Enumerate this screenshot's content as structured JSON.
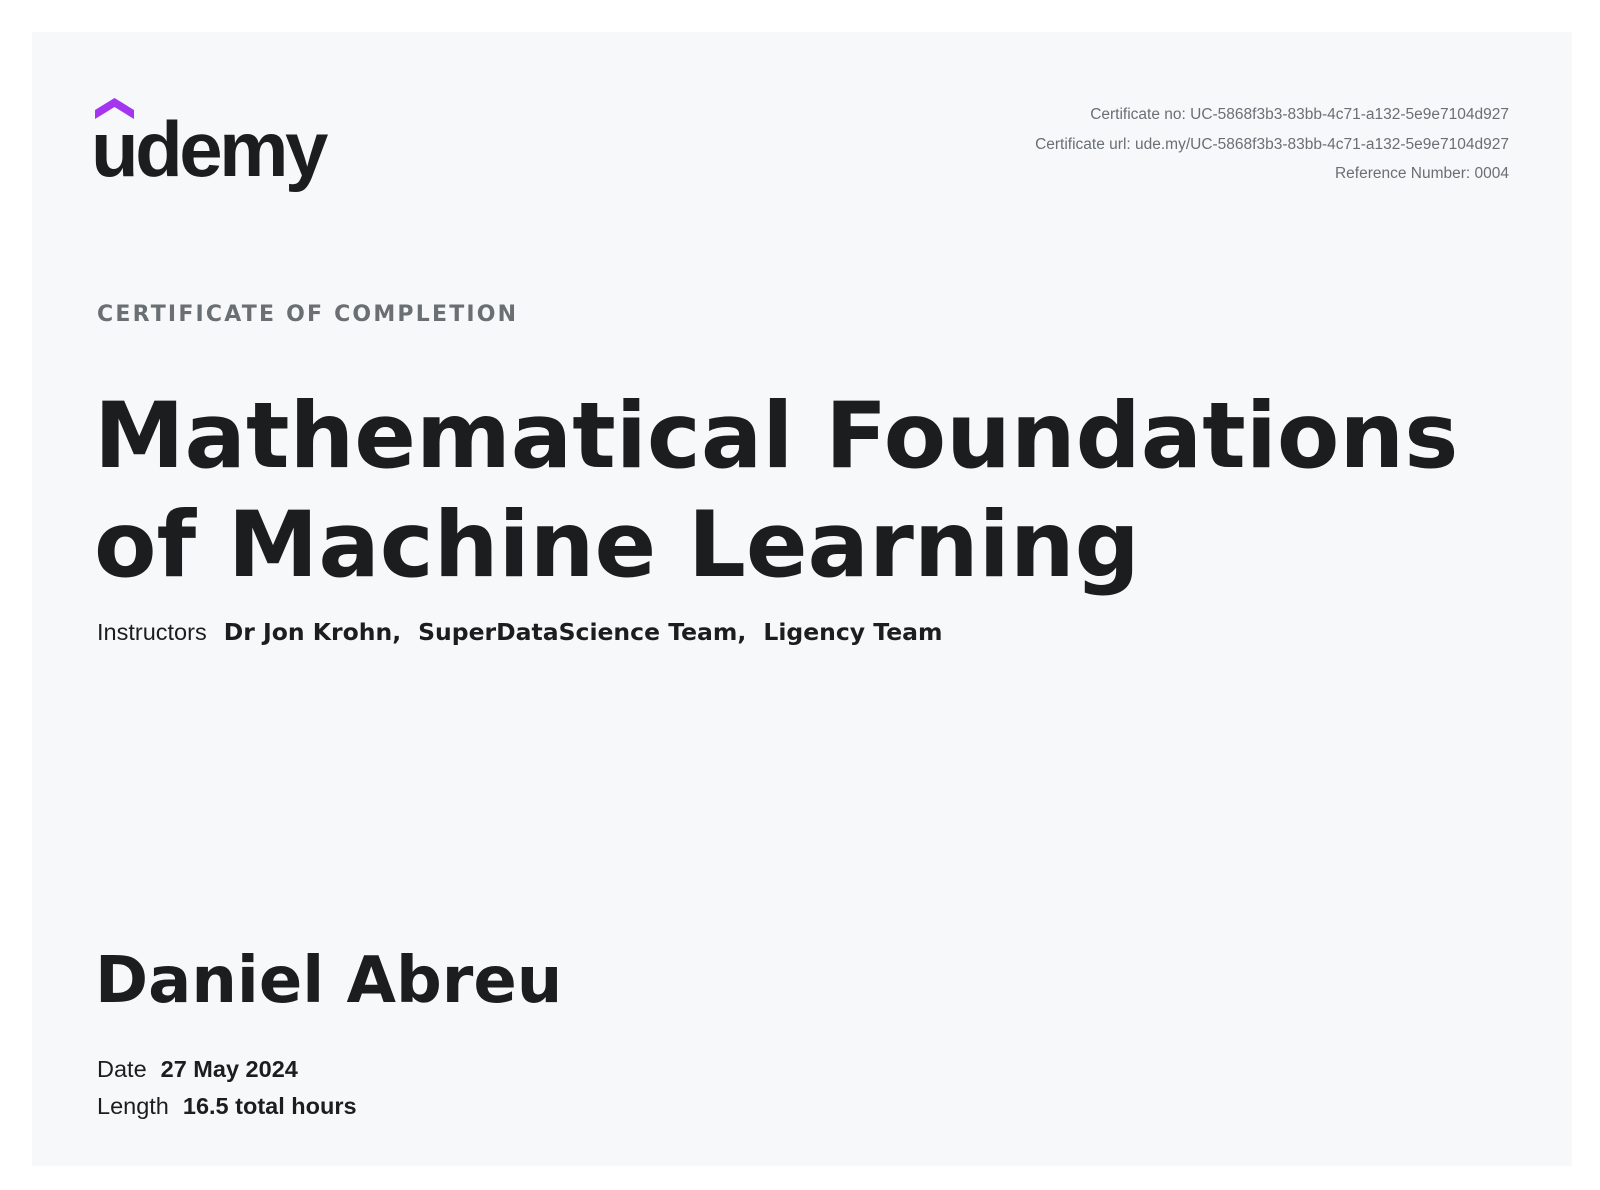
{
  "brand": {
    "logo_text": "udemy",
    "accent_color": "#a435f0",
    "ink_color": "#1c1d1f"
  },
  "certificate_meta": {
    "number_line": "Certificate no: UC-5868f3b3-83bb-4c71-a132-5e9e7104d927",
    "url_line": "Certificate url: ude.my/UC-5868f3b3-83bb-4c71-a132-5e9e7104d927",
    "reference_line": "Reference Number: 0004"
  },
  "heading": {
    "label": "CERTIFICATE OF COMPLETION",
    "course_title": "Mathematical Foundations of Machine Learning"
  },
  "instructors": {
    "label": "Instructors",
    "names": [
      "Dr Jon Krohn",
      "SuperDataScience Team",
      "Ligency Team"
    ],
    "separator": ","
  },
  "recipient": {
    "name": "Daniel Abreu"
  },
  "details": {
    "date_label": "Date",
    "date_value": "27 May 2024",
    "length_label": "Length",
    "length_value": "16.5 total hours"
  }
}
